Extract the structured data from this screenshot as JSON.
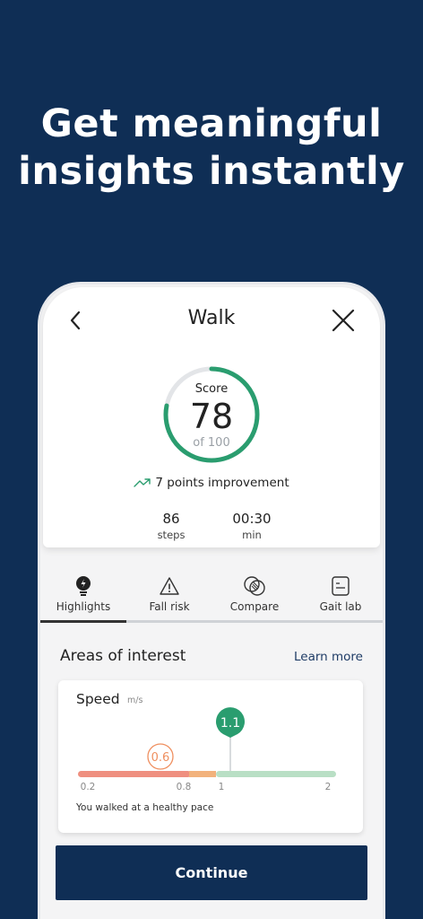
{
  "headline": {
    "line1": "Get meaningful",
    "line2": "insights instantly"
  },
  "nav": {
    "title": "Walk"
  },
  "score": {
    "label": "Score",
    "value": "78",
    "of": "of 100",
    "fraction": 0.78,
    "arc_color": "#2a9d6f"
  },
  "improvement": {
    "text": "7 points improvement"
  },
  "stats": [
    {
      "value": "86",
      "unit": "steps"
    },
    {
      "value": "00:30",
      "unit": "min"
    }
  ],
  "tabs": [
    {
      "label": "Highlights",
      "icon": "lightbulb-icon",
      "active": true
    },
    {
      "label": "Fall risk",
      "icon": "warning-icon",
      "active": false
    },
    {
      "label": "Compare",
      "icon": "compare-icon",
      "active": false
    },
    {
      "label": "Gait lab",
      "icon": "document-icon",
      "active": false
    }
  ],
  "areas": {
    "title": "Areas of interest",
    "learn_more": "Learn more"
  },
  "speed": {
    "title": "Speed",
    "unit": "m/s",
    "current": "1.1",
    "reference": "0.6",
    "ticks": [
      "0.2",
      "0.8",
      "1",
      "2"
    ],
    "message": "You walked at a healthy pace",
    "colors": {
      "low": "#ef8f7f",
      "mid": "#f2b27c",
      "high": "#b9dfc5",
      "marker": "#2a9d6f",
      "reference": "#ef8f5f"
    }
  },
  "continue_label": "Continue"
}
